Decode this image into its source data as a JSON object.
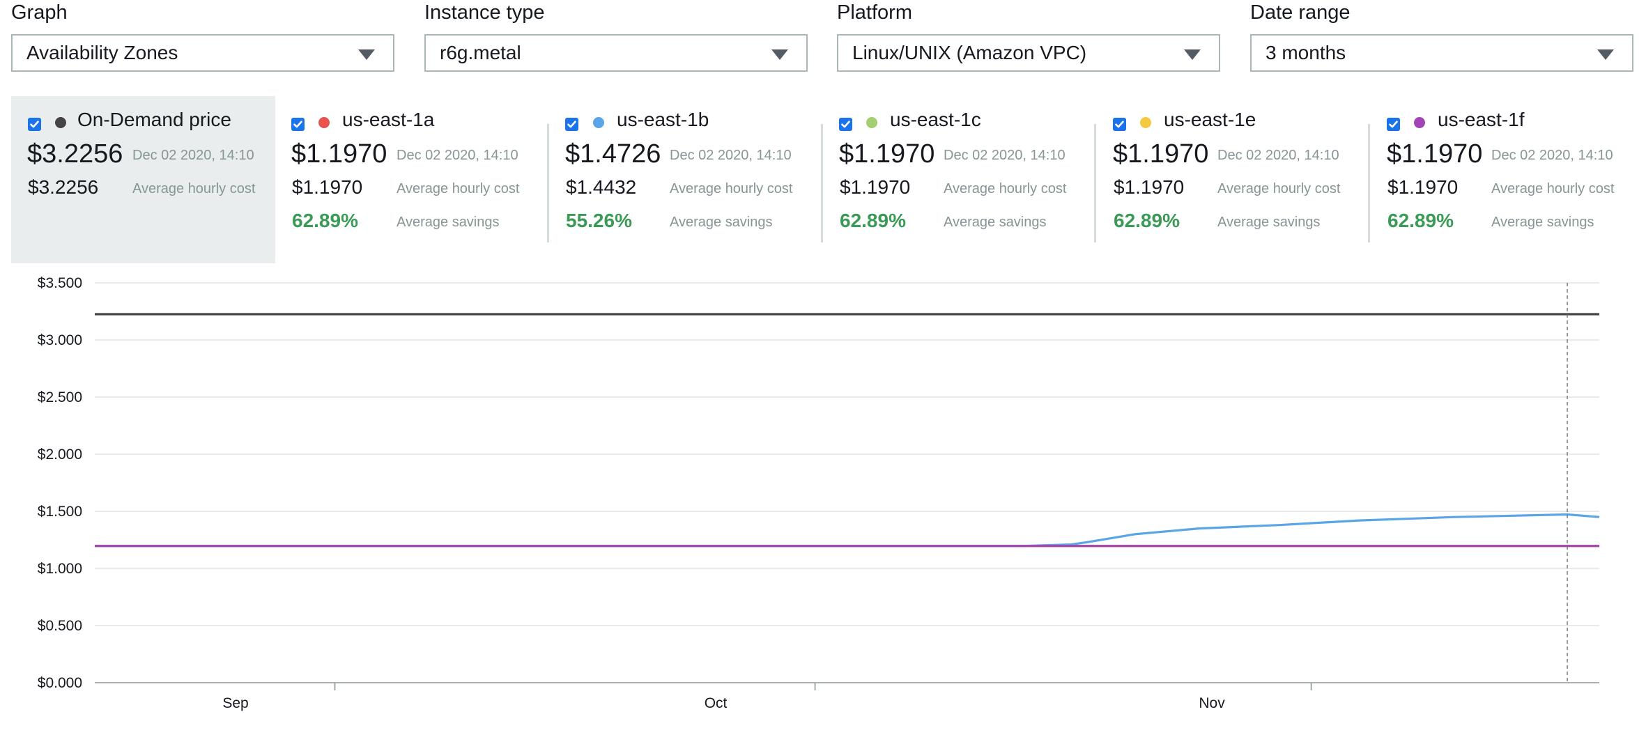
{
  "filters": [
    {
      "label": "Graph",
      "value": "Availability Zones"
    },
    {
      "label": "Instance type",
      "value": "r6g.metal"
    },
    {
      "label": "Platform",
      "value": "Linux/UNIX (Amazon VPC)"
    },
    {
      "label": "Date range",
      "value": "3 months"
    }
  ],
  "cards": [
    {
      "name": "On-Demand price",
      "color": "#444444",
      "checked": true,
      "price": "$3.2256",
      "date": "Dec 02 2020, 14:10",
      "avg_price": "$3.2256",
      "avg_label": "Average hourly cost",
      "savings": "",
      "savings_label": ""
    },
    {
      "name": "us-east-1a",
      "color": "#e8534b",
      "checked": true,
      "price": "$1.1970",
      "date": "Dec 02 2020, 14:10",
      "avg_price": "$1.1970",
      "avg_label": "Average hourly cost",
      "savings": "62.89%",
      "savings_label": "Average savings"
    },
    {
      "name": "us-east-1b",
      "color": "#5aa4e8",
      "checked": true,
      "price": "$1.4726",
      "date": "Dec 02 2020, 14:10",
      "avg_price": "$1.4432",
      "avg_label": "Average hourly cost",
      "savings": "55.26%",
      "savings_label": "Average savings"
    },
    {
      "name": "us-east-1c",
      "color": "#a3cf6f",
      "checked": true,
      "price": "$1.1970",
      "date": "Dec 02 2020, 14:10",
      "avg_price": "$1.1970",
      "avg_label": "Average hourly cost",
      "savings": "62.89%",
      "savings_label": "Average savings"
    },
    {
      "name": "us-east-1e",
      "color": "#f5c842",
      "checked": true,
      "price": "$1.1970",
      "date": "Dec 02 2020, 14:10",
      "avg_price": "$1.1970",
      "avg_label": "Average hourly cost",
      "savings": "62.89%",
      "savings_label": "Average savings"
    },
    {
      "name": "us-east-1f",
      "color": "#a244b5",
      "checked": true,
      "price": "$1.1970",
      "date": "Dec 02 2020, 14:10",
      "avg_price": "$1.1970",
      "avg_label": "Average hourly cost",
      "savings": "62.89%",
      "savings_label": "Average savings"
    }
  ],
  "chart_data": {
    "type": "line",
    "title": "",
    "xlabel": "",
    "ylabel": "",
    "x_range": [
      "2020-09-01",
      "2020-12-04"
    ],
    "x_ticks": [
      {
        "label": "Sep",
        "date": "2020-09-01"
      },
      {
        "label": "Oct",
        "date": "2020-10-01"
      },
      {
        "label": "Nov",
        "date": "2020-11-01"
      }
    ],
    "x_tick_marks": [
      "2020-09-16",
      "2020-10-16",
      "2020-11-16"
    ],
    "ylim": [
      0,
      3.5
    ],
    "y_ticks": [
      {
        "value": 0,
        "label": "$0.000"
      },
      {
        "value": 0.5,
        "label": "$0.500"
      },
      {
        "value": 1.0,
        "label": "$1.000"
      },
      {
        "value": 1.5,
        "label": "$1.500"
      },
      {
        "value": 2.0,
        "label": "$2.000"
      },
      {
        "value": 2.5,
        "label": "$2.500"
      },
      {
        "value": 3.0,
        "label": "$3.000"
      },
      {
        "value": 3.5,
        "label": "$3.500"
      }
    ],
    "grid": true,
    "cursor_date": "2020-12-02",
    "series": [
      {
        "name": "On-Demand price",
        "color": "#444444",
        "points": [
          [
            "2020-09-01",
            3.2256
          ],
          [
            "2020-12-04",
            3.2256
          ]
        ]
      },
      {
        "name": "us-east-1a",
        "color": "#e8534b",
        "points": [
          [
            "2020-09-01",
            1.197
          ],
          [
            "2020-12-04",
            1.197
          ]
        ]
      },
      {
        "name": "us-east-1c",
        "color": "#a3cf6f",
        "points": [
          [
            "2020-09-01",
            1.197
          ],
          [
            "2020-12-04",
            1.197
          ]
        ]
      },
      {
        "name": "us-east-1e",
        "color": "#f5c842",
        "points": [
          [
            "2020-09-01",
            1.197
          ],
          [
            "2020-12-04",
            1.197
          ]
        ]
      },
      {
        "name": "us-east-1b",
        "color": "#5aa4e8",
        "points": [
          [
            "2020-09-01",
            1.197
          ],
          [
            "2020-10-29",
            1.197
          ],
          [
            "2020-11-01",
            1.21
          ],
          [
            "2020-11-02",
            1.23
          ],
          [
            "2020-11-05",
            1.3
          ],
          [
            "2020-11-09",
            1.35
          ],
          [
            "2020-11-14",
            1.38
          ],
          [
            "2020-11-19",
            1.42
          ],
          [
            "2020-11-25",
            1.45
          ],
          [
            "2020-12-02",
            1.4726
          ],
          [
            "2020-12-04",
            1.45
          ]
        ]
      },
      {
        "name": "us-east-1f",
        "color": "#a244b5",
        "points": [
          [
            "2020-09-01",
            1.197
          ],
          [
            "2020-12-04",
            1.197
          ]
        ]
      }
    ]
  }
}
